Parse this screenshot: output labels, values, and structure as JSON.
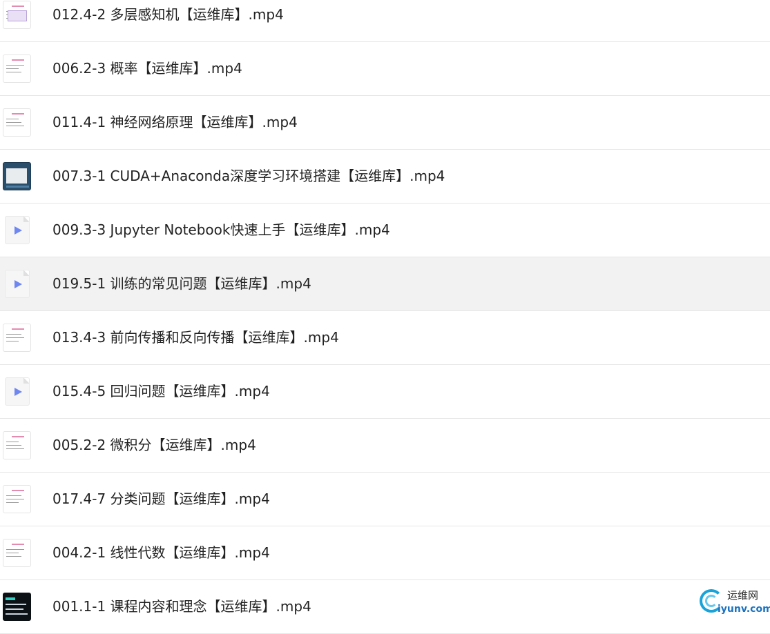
{
  "files": [
    {
      "name": "012.4-2 多层感知机【运维库】.mp4",
      "thumb": "slide",
      "selected": false
    },
    {
      "name": "006.2-3 概率【运维库】.mp4",
      "thumb": "slide",
      "selected": false
    },
    {
      "name": "011.4-1 神经网络原理【运维库】.mp4",
      "thumb": "slide",
      "selected": false
    },
    {
      "name": "007.3-1 CUDA+Anaconda深度学习环境搭建【运维库】.mp4",
      "thumb": "screen",
      "selected": false
    },
    {
      "name": "009.3-3 Jupyter Notebook快速上手【运维库】.mp4",
      "thumb": "video-icon",
      "selected": false
    },
    {
      "name": "019.5-1 训练的常见问题【运维库】.mp4",
      "thumb": "video-icon",
      "selected": true
    },
    {
      "name": "013.4-3 前向传播和反向传播【运维库】.mp4",
      "thumb": "slide",
      "selected": false
    },
    {
      "name": "015.4-5 回归问题【运维库】.mp4",
      "thumb": "video-icon",
      "selected": false
    },
    {
      "name": "005.2-2 微积分【运维库】.mp4",
      "thumb": "slide",
      "selected": false
    },
    {
      "name": "017.4-7 分类问题【运维库】.mp4",
      "thumb": "slide",
      "selected": false
    },
    {
      "name": "004.2-1 线性代数【运维库】.mp4",
      "thumb": "slide",
      "selected": false
    },
    {
      "name": "001.1-1 课程内容和理念【运维库】.mp4",
      "thumb": "dark",
      "selected": false
    }
  ],
  "watermark": {
    "cn": "运维网",
    "en": "iyunv.com"
  },
  "colors": {
    "selected_row": "#f2f2f2",
    "play_icon": "#6f87f0",
    "divider": "#e6e6e6"
  }
}
